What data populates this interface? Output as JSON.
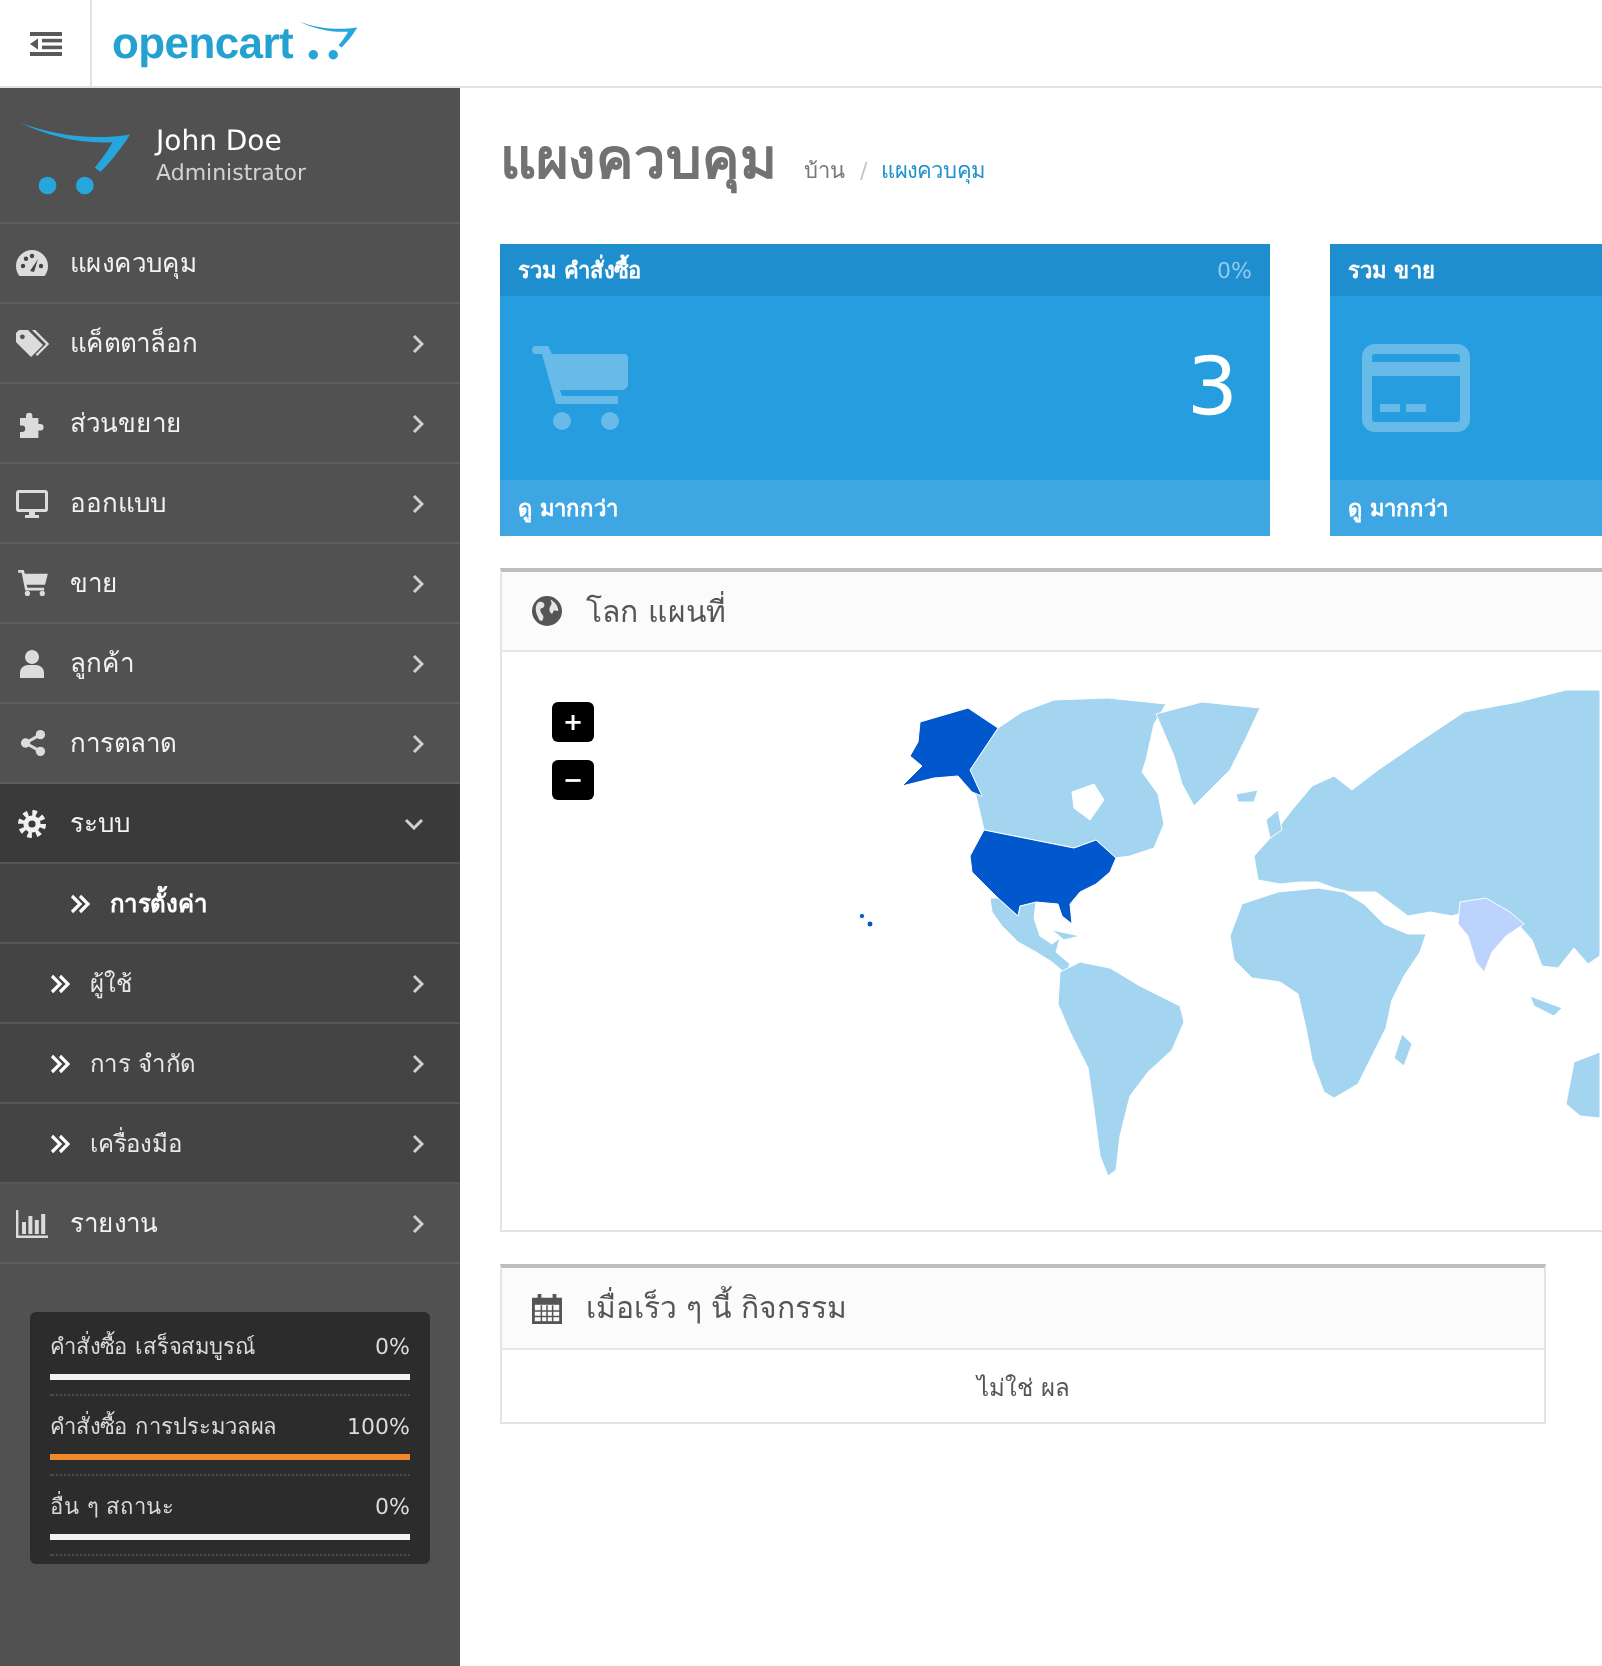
{
  "header": {
    "logo": "opencart"
  },
  "profile": {
    "name": "John Doe",
    "role": "Administrator"
  },
  "sidebar": {
    "items": [
      {
        "label": "แผงควบคุม",
        "selected": false
      },
      {
        "label": "แค็ตตาล็อก",
        "selected": false,
        "expanded": false
      },
      {
        "label": "ส่วนขยาย",
        "selected": false,
        "expanded": false
      },
      {
        "label": "ออกแบบ",
        "selected": false,
        "expanded": false
      },
      {
        "label": "ขาย",
        "selected": false,
        "expanded": false
      },
      {
        "label": "ลูกค้า",
        "selected": false,
        "expanded": false
      },
      {
        "label": "การตลาด",
        "selected": false,
        "expanded": false
      },
      {
        "label": "ระบบ",
        "selected": false,
        "expanded": true,
        "children": [
          {
            "label": "การตั้งค่า",
            "selected": true
          },
          {
            "label": "ผู้ใช้",
            "selected": false,
            "expanded": false
          },
          {
            "label": "การ จำกัด",
            "selected": false,
            "expanded": false
          },
          {
            "label": "เครื่องมือ",
            "selected": false,
            "expanded": false
          }
        ]
      },
      {
        "label": "รายงาน",
        "selected": false,
        "expanded": false
      }
    ]
  },
  "stats": [
    {
      "label": "คำสั่งซื้อ เสร็จสมบูรณ์",
      "value": "0%",
      "level": 0
    },
    {
      "label": "คำสั่งซื้อ การประมวลผล",
      "value": "100%",
      "level": 1
    },
    {
      "label": "อื่น ๆ สถานะ",
      "value": "0%",
      "level": 0
    }
  ],
  "page": {
    "title": "แผงควบคุม",
    "breadcrumb": [
      "บ้าน",
      "แผงควบคุม"
    ],
    "breadcrumb_separator": "/"
  },
  "tiles": [
    {
      "title": "รวม คำสั่งซื้อ",
      "percent": "0%",
      "value": "3",
      "link": "ดู มากกว่า"
    },
    {
      "title": "รวม ขาย",
      "link": "ดู มากกว่า"
    }
  ],
  "map_panel": {
    "title": "โลก แผนที่",
    "zoom_in": "+",
    "zoom_out": "−"
  },
  "activity_panel": {
    "title": "เมื่อเร็ว ๆ นี้ กิจกรรม",
    "empty_message": "ไม่ใช่ ผล"
  }
}
